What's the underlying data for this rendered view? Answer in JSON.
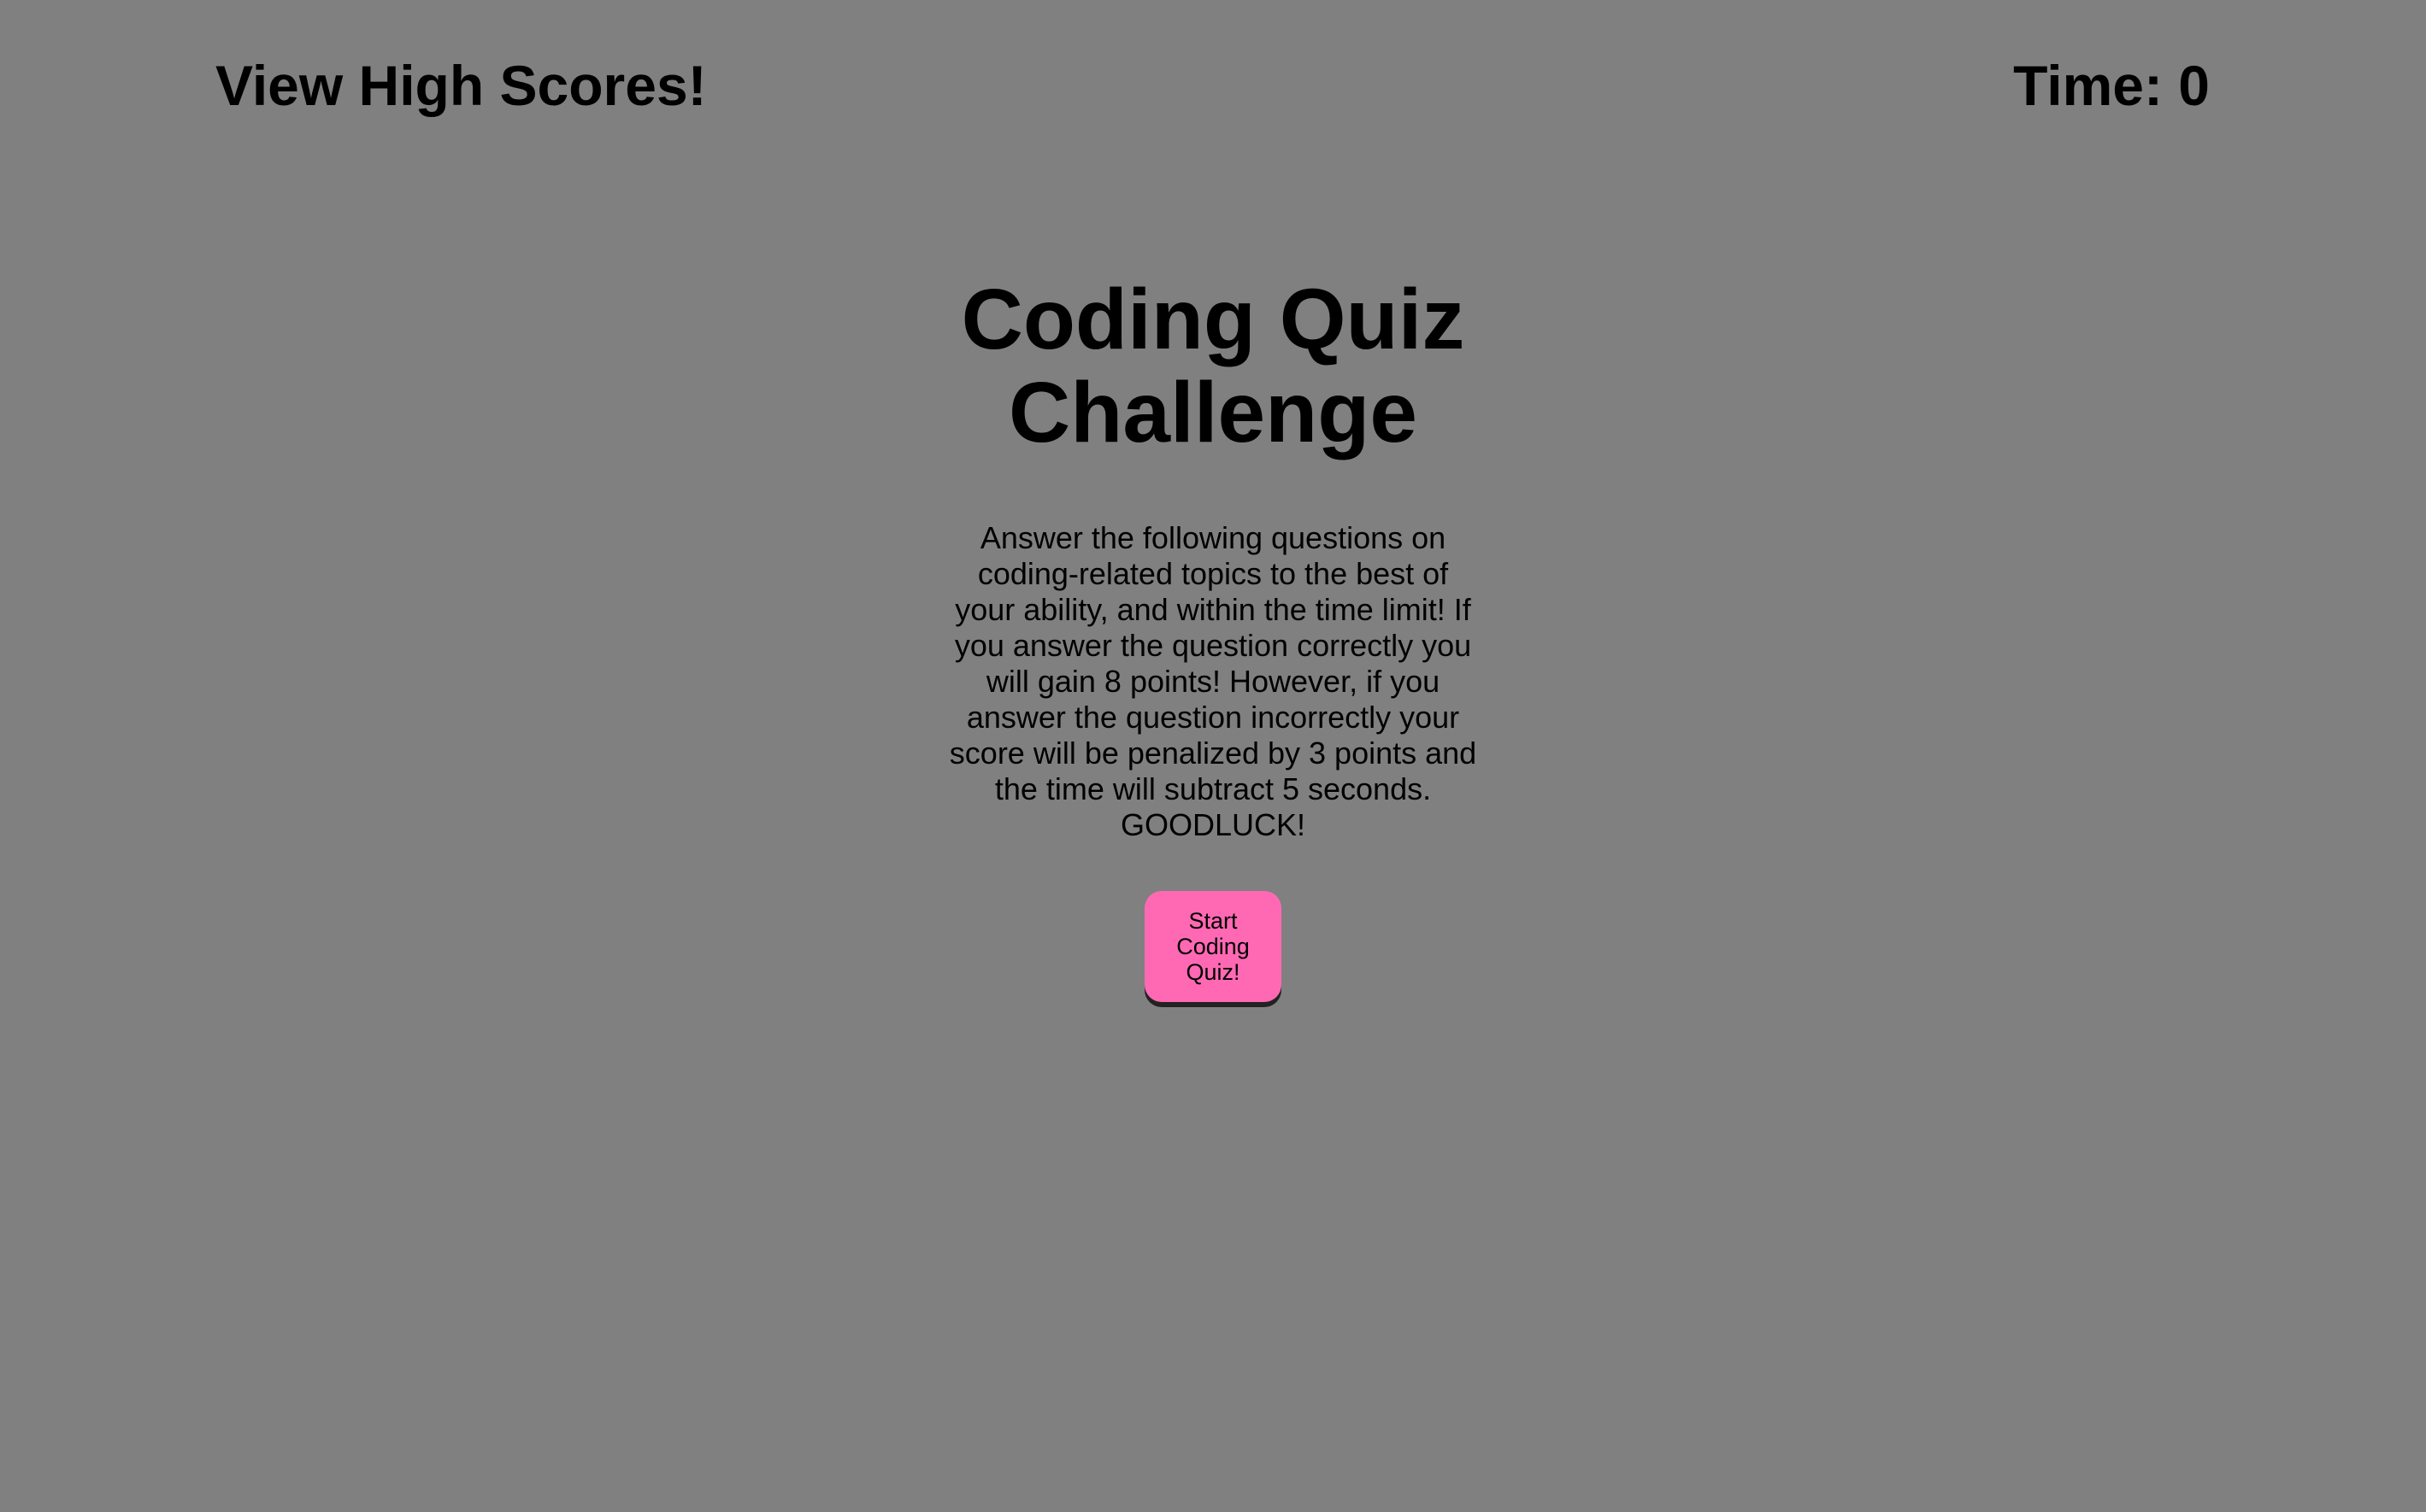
{
  "header": {
    "high_scores_label": "View High Scores!",
    "timer_label": "Time: 0"
  },
  "main": {
    "title": "Coding Quiz Challenge",
    "description": "Answer the following questions on coding-related topics to the best of your ability, and within the time limit! If you answer the question correctly you will gain 8 points! However, if you answer the question incorrectly your score will be penalized by 3 points and the time will subtract 5 seconds. GOODLUCK!",
    "start_button_label": "Start Coding Quiz!"
  },
  "colors": {
    "background": "#808080",
    "start_button": "#ff69b4",
    "text": "#000000"
  }
}
